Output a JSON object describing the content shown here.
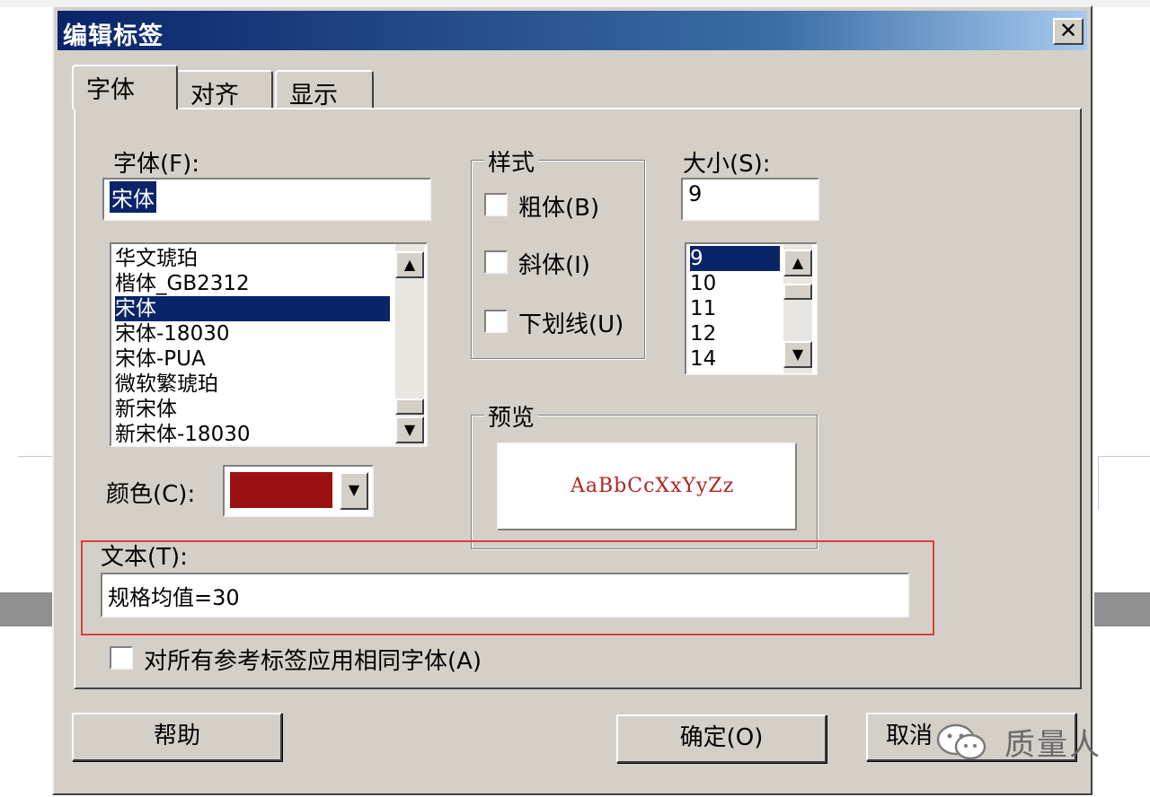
{
  "dialog": {
    "title": "编辑标签",
    "close_label": "✕"
  },
  "tabs": [
    {
      "label": "字体",
      "active": true
    },
    {
      "label": "对齐",
      "active": false
    },
    {
      "label": "显示",
      "active": false
    }
  ],
  "font": {
    "label": "字体(F):",
    "value": "宋体",
    "list": [
      "华文琥珀",
      "楷体_GB2312",
      "宋体",
      "宋体-18030",
      "宋体-PUA",
      "微软繁琥珀",
      "新宋体",
      "新宋体-18030"
    ],
    "selected": "宋体"
  },
  "style": {
    "group_label": "样式",
    "bold_label": "粗体(B)",
    "italic_label": "斜体(I)",
    "underline_label": "下划线(U)"
  },
  "size": {
    "label": "大小(S):",
    "value": "9",
    "list": [
      "9",
      "10",
      "11",
      "12",
      "14"
    ],
    "selected": "9"
  },
  "color": {
    "label": "颜色(C):",
    "value_hex": "#9b1010"
  },
  "preview": {
    "group_label": "预览",
    "text": "AaBbCcXxYyZz",
    "color": "#b22222"
  },
  "text_field": {
    "label": "文本(T):",
    "value": "规格均值=30"
  },
  "apply_all": {
    "label": "对所有参考标签应用相同字体(A)"
  },
  "buttons": {
    "help": "帮助",
    "ok": "确定(O)",
    "cancel": "取消"
  },
  "watermark": {
    "text": "质量人"
  }
}
